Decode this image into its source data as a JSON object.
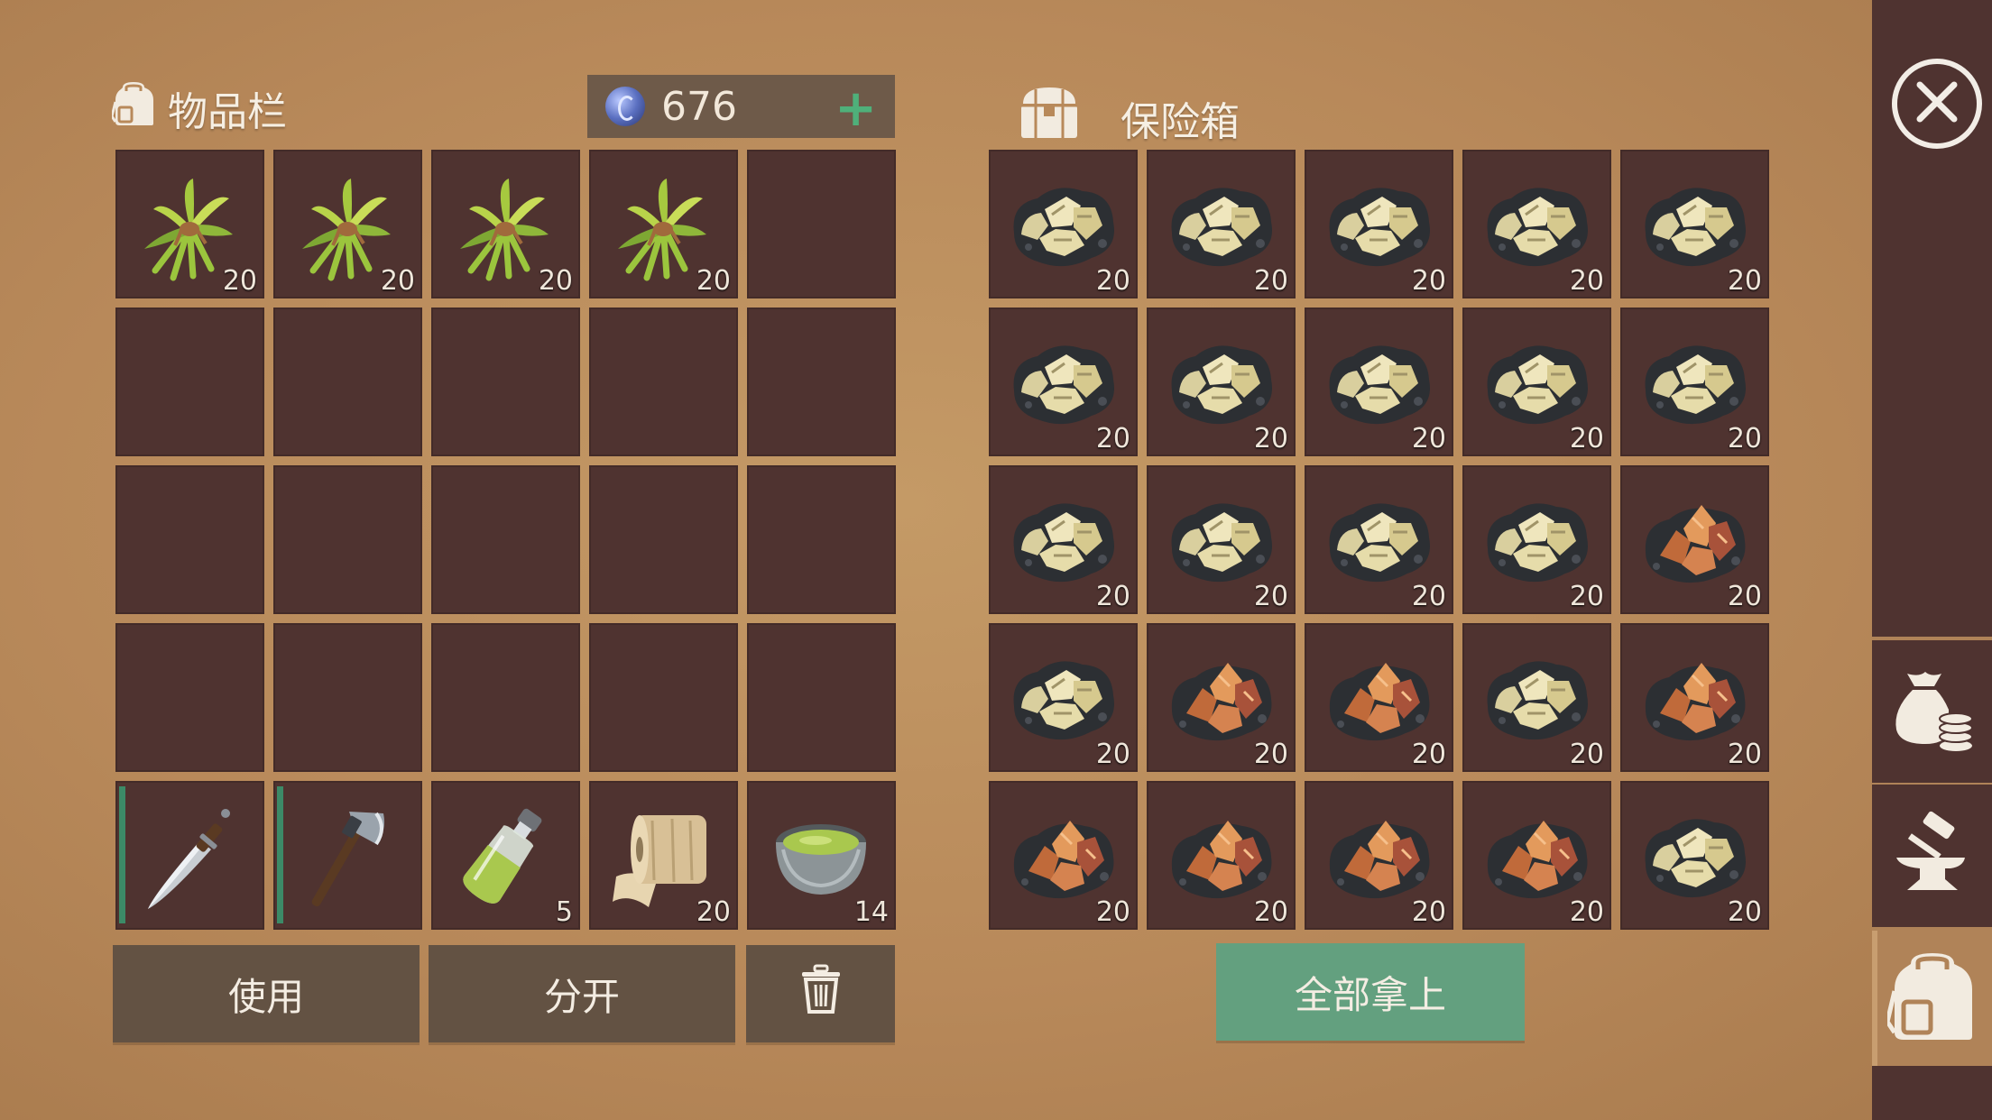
{
  "inventory": {
    "title": "物品栏",
    "currency": "676",
    "currency_add": "+",
    "slots": [
      {
        "item": "herb-bundle",
        "qty": "20"
      },
      {
        "item": "herb-bundle",
        "qty": "20"
      },
      {
        "item": "herb-bundle",
        "qty": "20"
      },
      {
        "item": "herb-bundle",
        "qty": "20"
      },
      {
        "item": "",
        "qty": ""
      },
      {
        "item": "",
        "qty": ""
      },
      {
        "item": "",
        "qty": ""
      },
      {
        "item": "",
        "qty": ""
      },
      {
        "item": "",
        "qty": ""
      },
      {
        "item": "",
        "qty": ""
      },
      {
        "item": "",
        "qty": ""
      },
      {
        "item": "",
        "qty": ""
      },
      {
        "item": "",
        "qty": ""
      },
      {
        "item": "",
        "qty": ""
      },
      {
        "item": "",
        "qty": ""
      },
      {
        "item": "",
        "qty": ""
      },
      {
        "item": "",
        "qty": ""
      },
      {
        "item": "",
        "qty": ""
      },
      {
        "item": "",
        "qty": ""
      },
      {
        "item": "",
        "qty": ""
      },
      {
        "item": "machete",
        "qty": "",
        "durability": true
      },
      {
        "item": "hatchet",
        "qty": "",
        "durability": true
      },
      {
        "item": "bottle",
        "qty": "5"
      },
      {
        "item": "cloth-roll",
        "qty": "20"
      },
      {
        "item": "bowl",
        "qty": "14"
      }
    ],
    "use_label": "使用",
    "split_label": "分开"
  },
  "safe": {
    "title": "保险箱",
    "slots": [
      {
        "item": "gold-ore",
        "qty": "20"
      },
      {
        "item": "gold-ore",
        "qty": "20"
      },
      {
        "item": "gold-ore",
        "qty": "20"
      },
      {
        "item": "gold-ore",
        "qty": "20"
      },
      {
        "item": "gold-ore",
        "qty": "20"
      },
      {
        "item": "gold-ore",
        "qty": "20"
      },
      {
        "item": "gold-ore",
        "qty": "20"
      },
      {
        "item": "gold-ore",
        "qty": "20"
      },
      {
        "item": "gold-ore",
        "qty": "20"
      },
      {
        "item": "gold-ore",
        "qty": "20"
      },
      {
        "item": "gold-ore",
        "qty": "20"
      },
      {
        "item": "gold-ore",
        "qty": "20"
      },
      {
        "item": "gold-ore",
        "qty": "20"
      },
      {
        "item": "gold-ore",
        "qty": "20"
      },
      {
        "item": "copper-ore",
        "qty": "20"
      },
      {
        "item": "gold-ore",
        "qty": "20"
      },
      {
        "item": "copper-ore",
        "qty": "20"
      },
      {
        "item": "copper-ore",
        "qty": "20"
      },
      {
        "item": "gold-ore",
        "qty": "20"
      },
      {
        "item": "copper-ore",
        "qty": "20"
      },
      {
        "item": "copper-ore",
        "qty": "20"
      },
      {
        "item": "copper-ore",
        "qty": "20"
      },
      {
        "item": "copper-ore",
        "qty": "20"
      },
      {
        "item": "copper-ore",
        "qty": "20"
      },
      {
        "item": "gold-ore",
        "qty": "20"
      }
    ],
    "take_all_label": "全部拿上"
  },
  "colors": {
    "background": "#b8895a",
    "slot": "#4f3330",
    "button": "#635243",
    "take_all": "#63a07f",
    "durability": "#3c8a67"
  }
}
